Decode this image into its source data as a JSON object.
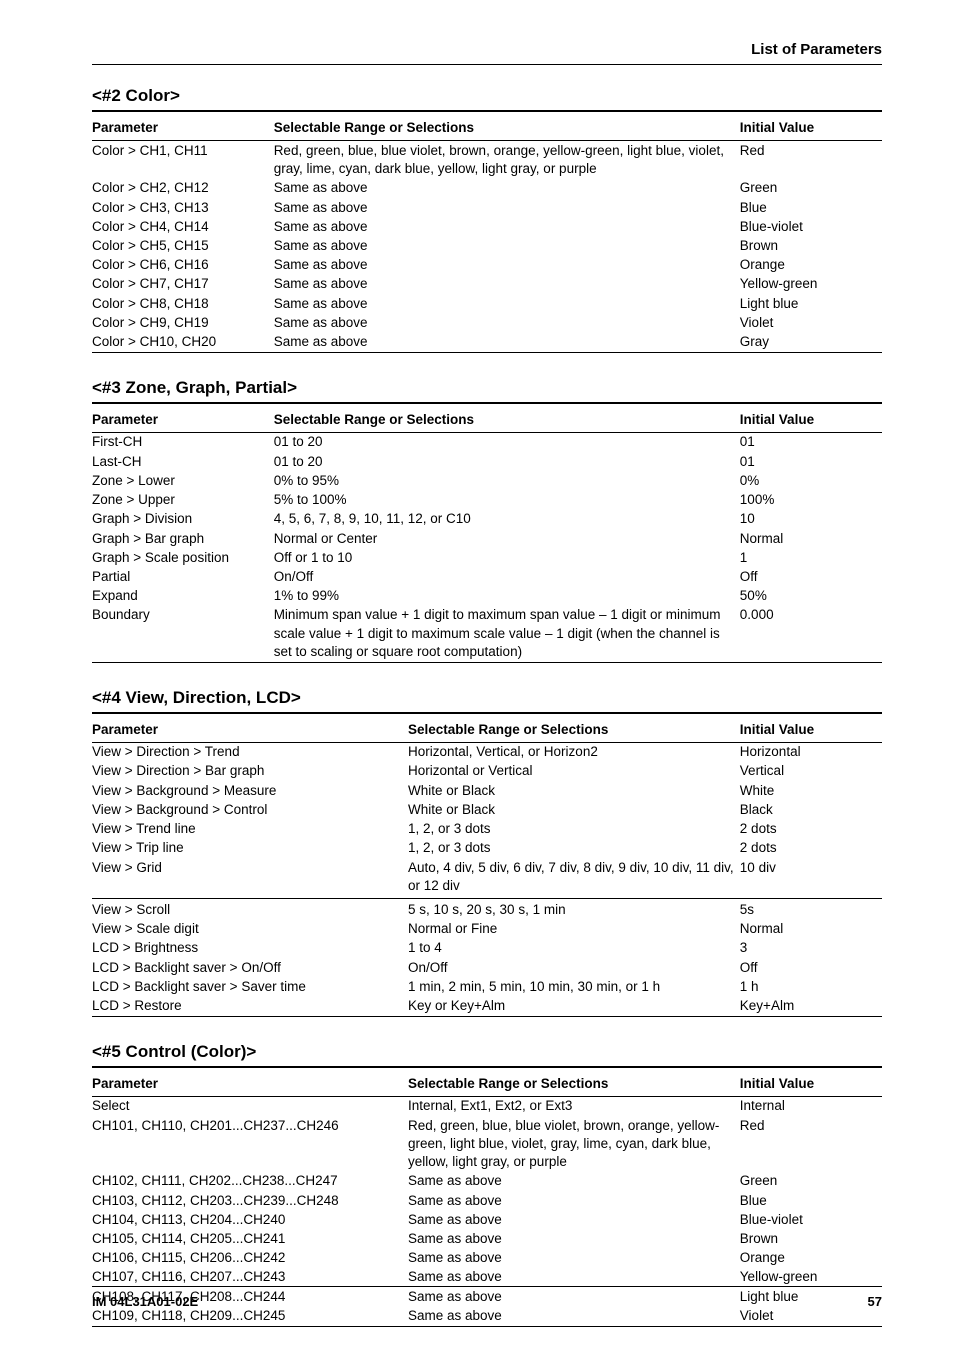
{
  "header": {
    "right_title": "List of Parameters"
  },
  "columns": {
    "param": "Parameter",
    "range": "Selectable Range or Selections",
    "init": "Initial Value"
  },
  "sections": {
    "s2": {
      "title": "<#2 Color>",
      "rows": [
        {
          "p": "Color > CH1, CH11",
          "r": "Red, green, blue, blue violet, brown, orange, yellow-green, light blue, violet, gray, lime, cyan, dark blue, yellow, light gray, or purple",
          "i": "Red"
        },
        {
          "p": "Color > CH2, CH12",
          "r": "Same as above",
          "i": "Green"
        },
        {
          "p": "Color > CH3, CH13",
          "r": "Same as above",
          "i": "Blue"
        },
        {
          "p": "Color > CH4, CH14",
          "r": "Same as above",
          "i": "Blue-violet"
        },
        {
          "p": "Color > CH5, CH15",
          "r": "Same as above",
          "i": "Brown"
        },
        {
          "p": "Color > CH6, CH16",
          "r": "Same as above",
          "i": "Orange"
        },
        {
          "p": "Color > CH7, CH17",
          "r": "Same as above",
          "i": "Yellow-green"
        },
        {
          "p": "Color > CH8, CH18",
          "r": "Same as above",
          "i": "Light blue"
        },
        {
          "p": "Color > CH9, CH19",
          "r": "Same as above",
          "i": "Violet"
        },
        {
          "p": "Color > CH10, CH20",
          "r": "Same as above",
          "i": "Gray"
        }
      ]
    },
    "s3": {
      "title": "<#3 Zone, Graph, Partial>",
      "rows": [
        {
          "p": "First-CH",
          "r": "01 to 20",
          "i": "01"
        },
        {
          "p": "Last-CH",
          "r": "01 to 20",
          "i": "01"
        },
        {
          "p": "Zone > Lower",
          "r": "0% to 95%",
          "i": "0%"
        },
        {
          "p": "Zone > Upper",
          "r": "5% to 100%",
          "i": "100%"
        },
        {
          "p": "Graph > Division",
          "r": "4, 5, 6, 7, 8, 9, 10, 11, 12, or C10",
          "i": "10"
        },
        {
          "p": "Graph > Bar graph",
          "r": "Normal or Center",
          "i": "Normal"
        },
        {
          "p": "Graph > Scale position",
          "r": "Off or 1 to 10",
          "i": "1"
        },
        {
          "p": "Partial",
          "r": "On/Off",
          "i": "Off"
        },
        {
          "p": "Expand",
          "r": "1% to 99%",
          "i": "50%"
        },
        {
          "p": "Boundary",
          "r": "Minimum span value + 1 digit to maximum span value – 1 digit or minimum scale value + 1 digit to maximum scale value – 1 digit (when the channel is set to scaling or square root computation)",
          "i": "0.000"
        }
      ]
    },
    "s4": {
      "title": "<#4 View, Direction, LCD>",
      "rows_a": [
        {
          "p": "View > Direction > Trend",
          "r": "Horizontal, Vertical, or Horizon2",
          "i": "Horizontal"
        },
        {
          "p": "View > Direction > Bar graph",
          "r": "Horizontal or Vertical",
          "i": "Vertical"
        },
        {
          "p": "View > Background > Measure",
          "r": "White or Black",
          "i": "White"
        },
        {
          "p": "View > Background > Control",
          "r": "White or Black",
          "i": "Black"
        },
        {
          "p": "View > Trend line",
          "r": "1, 2, or 3 dots",
          "i": "2 dots"
        },
        {
          "p": "View > Trip line",
          "r": "1, 2, or 3 dots",
          "i": "2 dots"
        },
        {
          "p": "View > Grid",
          "r": "Auto, 4 div, 5 div, 6 div, 7 div, 8 div, 9 div, 10 div, 11 div, or 12 div",
          "i": "10 div"
        }
      ],
      "rows_b": [
        {
          "p": "View > Scroll",
          "r": "5 s, 10 s, 20 s, 30 s, 1 min",
          "i": "5s"
        },
        {
          "p": "View > Scale digit",
          "r": "Normal or Fine",
          "i": "Normal"
        },
        {
          "p": "LCD > Brightness",
          "r": "1 to 4",
          "i": "3"
        },
        {
          "p": "LCD > Backlight saver > On/Off",
          "r": "On/Off",
          "i": "Off"
        },
        {
          "p": "LCD > Backlight saver > Saver time",
          "r": "1 min, 2 min, 5 min, 10 min, 30 min, or 1 h",
          "i": "1 h"
        },
        {
          "p": "LCD > Restore",
          "r": "Key or Key+Alm",
          "i": "Key+Alm"
        }
      ]
    },
    "s5": {
      "title": "<#5 Control (Color)>",
      "rows": [
        {
          "p": "Select",
          "r": "Internal, Ext1, Ext2, or Ext3",
          "i": "Internal"
        },
        {
          "p": "CH101, CH110, CH201...CH237...CH246",
          "r": "Red, green, blue, blue violet, brown, orange, yellow-green, light blue, violet, gray, lime, cyan, dark blue, yellow, light gray, or purple",
          "i": "Red"
        },
        {
          "p": "CH102, CH111, CH202...CH238...CH247",
          "r": "Same as above",
          "i": "Green"
        },
        {
          "p": "CH103, CH112, CH203...CH239...CH248",
          "r": "Same as above",
          "i": "Blue"
        },
        {
          "p": "CH104, CH113, CH204...CH240",
          "r": "Same as above",
          "i": "Blue-violet"
        },
        {
          "p": "CH105, CH114, CH205...CH241",
          "r": "Same as above",
          "i": "Brown"
        },
        {
          "p": "CH106, CH115, CH206...CH242",
          "r": "Same as above",
          "i": "Orange"
        },
        {
          "p": "CH107, CH116, CH207...CH243",
          "r": "Same as above",
          "i": "Yellow-green"
        },
        {
          "p": "CH108, CH117, CH208...CH244",
          "r": "Same as above",
          "i": "Light blue"
        },
        {
          "p": "CH109, CH118, CH209...CH245",
          "r": "Same as above",
          "i": "Violet"
        }
      ]
    }
  },
  "footer": {
    "left": "IM 04L31A01-02E",
    "right": "57"
  }
}
